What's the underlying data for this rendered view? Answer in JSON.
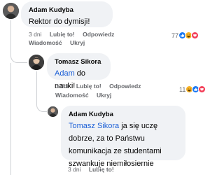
{
  "comments": [
    {
      "author": "Adam Kudyba",
      "text": "Rektor do dymisji!",
      "time": "3 dni",
      "like_label": "Lubię to!",
      "reply_label": "Odpowiedz",
      "message_label": "Wiadomość",
      "hide_label": "Ukryj",
      "reaction_count": "77",
      "reactions": [
        "like-icon",
        "laugh-icon",
        "love-icon"
      ]
    },
    {
      "author": "Tomasz Sikora",
      "mention": "Adam",
      "text": " do nauki!",
      "time": "3 dni",
      "like_label": "Lubię to!",
      "reply_label": "Odpowiedz",
      "message_label": "Wiadomość",
      "hide_label": "Ukryj",
      "reaction_count": "11",
      "reactions": [
        "laugh-icon",
        "like-icon",
        "love-icon"
      ]
    },
    {
      "author": "Adam Kudyba",
      "mention": "Tomasz Sikora",
      "text": " ja się uczę dobrze, za to Państwu komunikacja ze studentami szwankuje niemiłosiernie",
      "time": "3 dni",
      "like_label": "Lubię to!"
    }
  ],
  "colors": {
    "bubble": "#f0f2f5",
    "mention": "#1b5fd6",
    "meta": "#65676b",
    "like": "#1877f2",
    "love": "#f33e58",
    "haha": "#f7b125"
  }
}
